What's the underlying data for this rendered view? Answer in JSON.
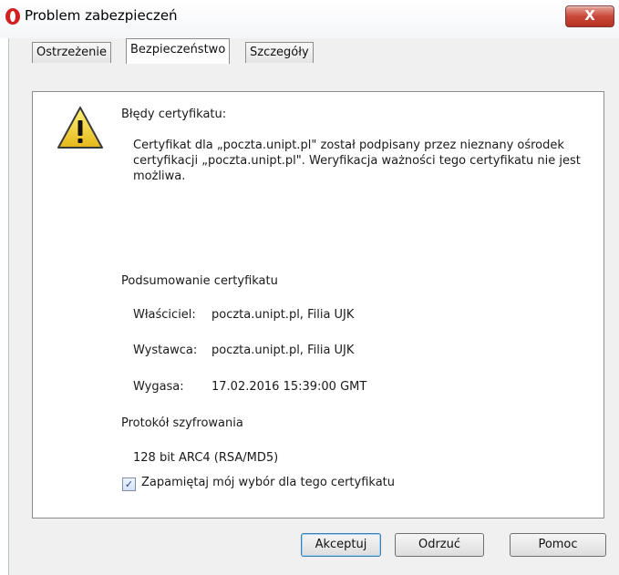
{
  "window": {
    "title": "Problem zabezpieczeń",
    "close_label": "X"
  },
  "tabs": [
    "Ostrzeżenie",
    "Bezpieczeństwo",
    "Szczegóły"
  ],
  "active_tab": "Bezpieczeństwo",
  "security": {
    "errors_heading": "Błędy certyfikatu:",
    "error_description": "Certyfikat dla „poczta.unipt.pl\" został podpisany przez nieznany ośrodek certyfikacji „poczta.unipt.pl\". Weryfikacja ważności tego certyfikatu nie jest możliwa.",
    "summary_heading": "Podsumowanie certyfikatu",
    "owner_label": "Właściciel:",
    "owner_value": "poczta.unipt.pl, Filia UJK",
    "issuer_label": "Wystawca:",
    "issuer_value": "poczta.unipt.pl, Filia UJK",
    "expires_label": "Wygasa:",
    "expires_value": "17.02.2016 15:39:00 GMT",
    "protocol_heading": "Protokół szyfrowania",
    "protocol_value": "128 bit ARC4 (RSA/MD5)"
  },
  "remember_choice": {
    "label": "Zapamiętaj mój wybór dla tego certyfikatu",
    "checked": true,
    "check_mark": "✓"
  },
  "buttons": {
    "accept": "Akceptuj",
    "reject": "Odrzuć",
    "help": "Pomoc"
  },
  "colors": {
    "warning_yellow": "#f4d23c",
    "warning_outline": "#3a3a3a",
    "close_red": "#c9483a"
  }
}
